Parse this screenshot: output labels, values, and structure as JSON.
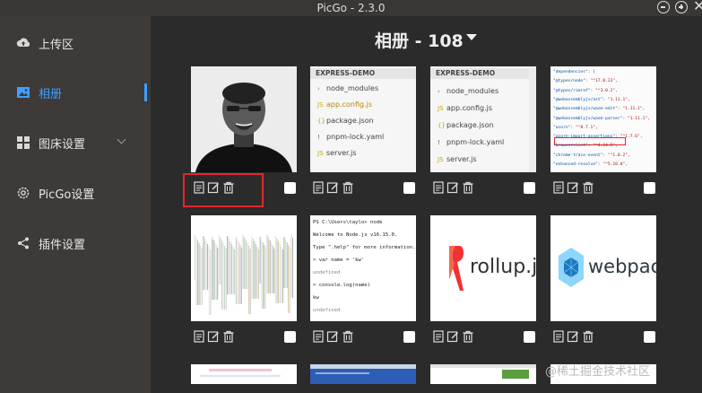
{
  "window": {
    "title": "PicGo - 2.3.0"
  },
  "sidebar": {
    "items": [
      {
        "label": "上传区",
        "icon": "cloud-upload-icon",
        "active": false
      },
      {
        "label": "相册",
        "icon": "picture-icon",
        "active": true
      },
      {
        "label": "图床设置",
        "icon": "grid-icon",
        "active": false,
        "expandable": true
      },
      {
        "label": "PicGo设置",
        "icon": "gear-icon",
        "active": false
      },
      {
        "label": "插件设置",
        "icon": "share-icon",
        "active": false
      }
    ]
  },
  "gallery": {
    "heading": "相册 - 108",
    "images": [
      {
        "kind": "photo",
        "description": "portrait photo"
      },
      {
        "kind": "editor",
        "header": "EXPRESS-DEMO",
        "rows": [
          "node_modules",
          "app.config.js",
          "package.json",
          "pnpm-lock.yaml",
          "server.js"
        ]
      },
      {
        "kind": "editor",
        "header": "EXPRESS-DEMO",
        "rows": [
          "node_modules",
          "app.config.js",
          "package.json",
          "pnpm-lock.yaml",
          "server.js"
        ]
      },
      {
        "kind": "json"
      },
      {
        "kind": "noise"
      },
      {
        "kind": "terminal",
        "lines": [
          "PS C:\\Users\\taylo> node",
          "Welcome to Node.js v16.15.0.",
          "Type \".help\" for more information.",
          "> var name = 'kw'",
          "undefined",
          "> console.log(name)",
          "kw",
          "undefined"
        ]
      },
      {
        "kind": "logo",
        "text": "rollup.js"
      },
      {
        "kind": "logo",
        "text": "webpack"
      }
    ]
  },
  "json_lines": [
    [
      "\"dependencies\": {",
      ""
    ],
    [
      "  \"@types/node\": ",
      "\"^17.0.23\","
    ],
    [
      "  \"@types/rimraf\": ",
      "\"^3.0.2\","
    ],
    [
      "  \"@webassemblyjs/ast\": ",
      "\"1.11.1\","
    ],
    [
      "  \"@webassemblyjs/wasm-edit\": ",
      "\"1.11.1\","
    ],
    [
      "  \"@webassemblyjs/wasm-parser\": ",
      "\"1.11.1\","
    ],
    [
      "  \"acorn\": ",
      "\"^8.7.1\","
    ],
    [
      "  \"acorn-import-assertions\": ",
      "\"^1.7.6\","
    ],
    [
      "  \"browserslist\": ",
      "\"^4.14.5\","
    ],
    [
      "  \"chrome-trace-event\": ",
      "\"^1.0.2\","
    ],
    [
      "  \"enhanced-resolve\": ",
      "\"^5.10.0\","
    ]
  ],
  "watermark": "@稀土掘金技术社区",
  "colors": {
    "accent": "#409eff",
    "highlight": "#e3262d",
    "sidebar": "#3d3a37",
    "main": "#2b2b2b"
  }
}
